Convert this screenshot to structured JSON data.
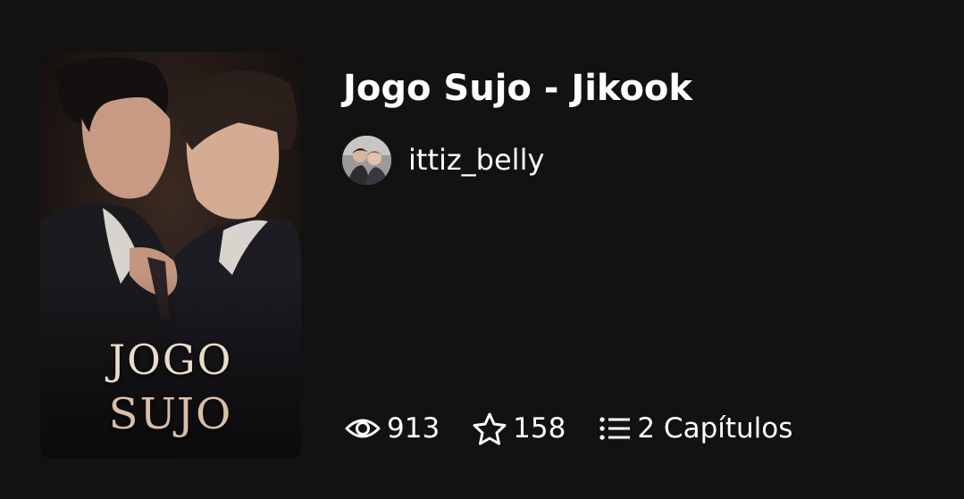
{
  "story": {
    "cover_text_line1": "JOGO",
    "cover_text_line2": "SUJO",
    "title": "Jogo Sujo - Jikook",
    "author": "ittiz_belly",
    "stats": {
      "reads": "913",
      "votes": "158",
      "chapters": "2 Capítulos"
    },
    "icons": {
      "reads": "eye-icon",
      "votes": "star-icon",
      "chapters": "list-icon"
    }
  },
  "colors": {
    "background": "#121212",
    "text": "#ffffff"
  }
}
